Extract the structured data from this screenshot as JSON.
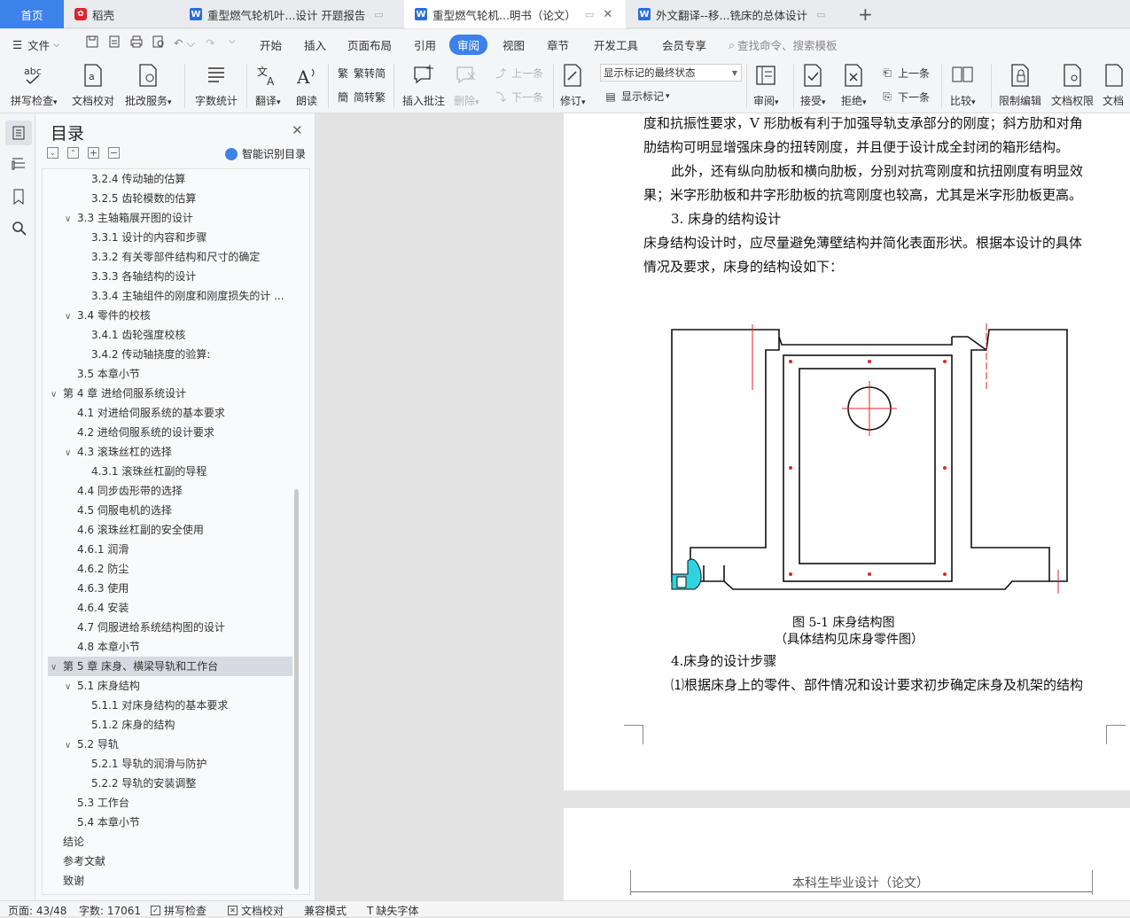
{
  "tabs": [
    {
      "label": "首页"
    },
    {
      "label": "稻壳"
    },
    {
      "label": "重型燃气轮机叶...设计 开题报告"
    },
    {
      "label": "重型燃气轮机...明书（论文）"
    },
    {
      "label": "外文翻译--移...铣床的总体设计"
    }
  ],
  "new_tab": "+",
  "menu": {
    "file": "文件",
    "items": [
      "开始",
      "插入",
      "页面布局",
      "引用",
      "审阅",
      "视图",
      "章节",
      "开发工具",
      "会员专享"
    ],
    "search": "查找命令、搜索模板"
  },
  "ribbon": {
    "spell": "拼写检查",
    "doc_check": "文档校对",
    "annot_service": "批改服务",
    "word_count": "字数统计",
    "translate": "翻译",
    "read": "朗读",
    "t2s": "繁转简",
    "s2t": "简转繁",
    "insert_comment": "插入批注",
    "delete": "删除",
    "prev_c": "上一条",
    "next_c": "下一条",
    "revise": "修订",
    "markup_state": "显示标记的最终状态",
    "show_markup": "显示标记",
    "review": "审阅",
    "accept": "接受",
    "reject": "拒绝",
    "prev": "上一条",
    "next": "下一条",
    "compare": "比较",
    "restrict": "限制编辑",
    "doc_perm": "文档权限",
    "doc_more": "文档"
  },
  "toc": {
    "title": "目录",
    "smart": "智能识别目录",
    "items": [
      {
        "text": "3.2.4 传动轴的估算",
        "lvl": 3,
        "car": ""
      },
      {
        "text": "3.2.5 齿轮模数的估算",
        "lvl": 3,
        "car": ""
      },
      {
        "text": "3.3 主轴箱展开图的设计",
        "lvl": 2,
        "car": "v"
      },
      {
        "text": "3.3.1 设计的内容和步骤",
        "lvl": 3,
        "car": ""
      },
      {
        "text": "3.3.2  有关零部件结构和尺寸的确定",
        "lvl": 3,
        "car": ""
      },
      {
        "text": "3.3.3  各轴结构的设计",
        "lvl": 3,
        "car": ""
      },
      {
        "text": "3.3.4  主轴组件的刚度和刚度损失的计 ...",
        "lvl": 3,
        "car": ""
      },
      {
        "text": "3.4  零件的校核",
        "lvl": 2,
        "car": "v"
      },
      {
        "text": "3.4.1 齿轮强度校核",
        "lvl": 3,
        "car": ""
      },
      {
        "text": "3.4.2 传动轴挠度的验算:",
        "lvl": 3,
        "car": ""
      },
      {
        "text": "3.5  本章小节",
        "lvl": 2,
        "car": ""
      },
      {
        "text": "第 4 章  进给伺服系统设计",
        "lvl": 1,
        "car": "v"
      },
      {
        "text": "4.1  对进给伺服系统的基本要求",
        "lvl": 2,
        "car": ""
      },
      {
        "text": "4.2 进给伺服系统的设计要求",
        "lvl": 2,
        "car": ""
      },
      {
        "text": "4.3 滚珠丝杠的选择",
        "lvl": 2,
        "car": "v"
      },
      {
        "text": "4.3.1  滚珠丝杠副的导程",
        "lvl": 3,
        "car": ""
      },
      {
        "text": "4.4 同步齿形带的选择",
        "lvl": 2,
        "car": ""
      },
      {
        "text": "4.5 伺服电机的选择",
        "lvl": 2,
        "car": ""
      },
      {
        "text": "4.6  滚珠丝杠副的安全使用",
        "lvl": 2,
        "car": ""
      },
      {
        "text": "4.6.1  润滑",
        "lvl": 2,
        "car": ""
      },
      {
        "text": "4.6.2  防尘",
        "lvl": 2,
        "car": ""
      },
      {
        "text": "4.6.3 使用",
        "lvl": 2,
        "car": ""
      },
      {
        "text": "4.6.4  安装",
        "lvl": 2,
        "car": ""
      },
      {
        "text": "4.7  伺服进给系统结构图的设计",
        "lvl": 2,
        "car": ""
      },
      {
        "text": "4.8  本章小节",
        "lvl": 2,
        "car": ""
      },
      {
        "text": "第 5 章  床身、横梁导轨和工作台",
        "lvl": 1,
        "car": "v",
        "sel": true
      },
      {
        "text": "5.1  床身结构",
        "lvl": 2,
        "car": "v"
      },
      {
        "text": "5.1.1  对床身结构的基本要求",
        "lvl": 3,
        "car": ""
      },
      {
        "text": "5.1.2  床身的结构",
        "lvl": 3,
        "car": ""
      },
      {
        "text": "5.2  导轨",
        "lvl": 2,
        "car": "v"
      },
      {
        "text": "5.2.1  导轨的润滑与防护",
        "lvl": 3,
        "car": ""
      },
      {
        "text": "5.2.2  导轨的安装调整",
        "lvl": 3,
        "car": ""
      },
      {
        "text": "5.3  工作台",
        "lvl": 2,
        "car": ""
      },
      {
        "text": "5.4  本章小节",
        "lvl": 2,
        "car": ""
      },
      {
        "text": "结论",
        "lvl": 1,
        "car": ""
      },
      {
        "text": "参考文献",
        "lvl": 1,
        "car": ""
      },
      {
        "text": "致谢",
        "lvl": 1,
        "car": ""
      }
    ]
  },
  "doc": {
    "l1": "度和抗振性要求，V 形肋板有利于加强导轨支承部分的刚度；斜方肋和对角",
    "l2": "肋结构可明显增强床身的扭转刚度，并且便于设计成全封闭的箱形结构。",
    "l3": "此外，还有纵向肋板和横向肋板，分别对抗弯刚度和抗扭刚度有明显效",
    "l4": "果；米字形肋板和井字形肋板的抗弯刚度也较高，尤其是米字形肋板更高。",
    "l5": "3. 床身的结构设计",
    "l6": "床身结构设计时，应尽量避免薄壁结构并简化表面形状。根据本设计的具体",
    "l7": "情况及要求，床身的结构设如下：",
    "cap1": "图 5-1 床身结构图",
    "cap2": "（具体结构见床身零件图）",
    "l8": "4.床身的设计步骤",
    "l9": "⑴根据床身上的零件、部件情况和设计要求初步确定床身及机架的结构",
    "header2": "本科生毕业设计（论文）"
  },
  "status": {
    "page": "页面: 43/48",
    "words": "字数: 17061",
    "spell": "拼写检查",
    "proof": "文档校对",
    "compat": "兼容模式",
    "font": "缺失字体"
  },
  "colors": {
    "accent": "#2b6fd8",
    "active_tab": "#3c82e8",
    "red_accent": "#d8262d",
    "cad_red": "#e0262a",
    "cad_cyan": "#2fd3e0"
  }
}
